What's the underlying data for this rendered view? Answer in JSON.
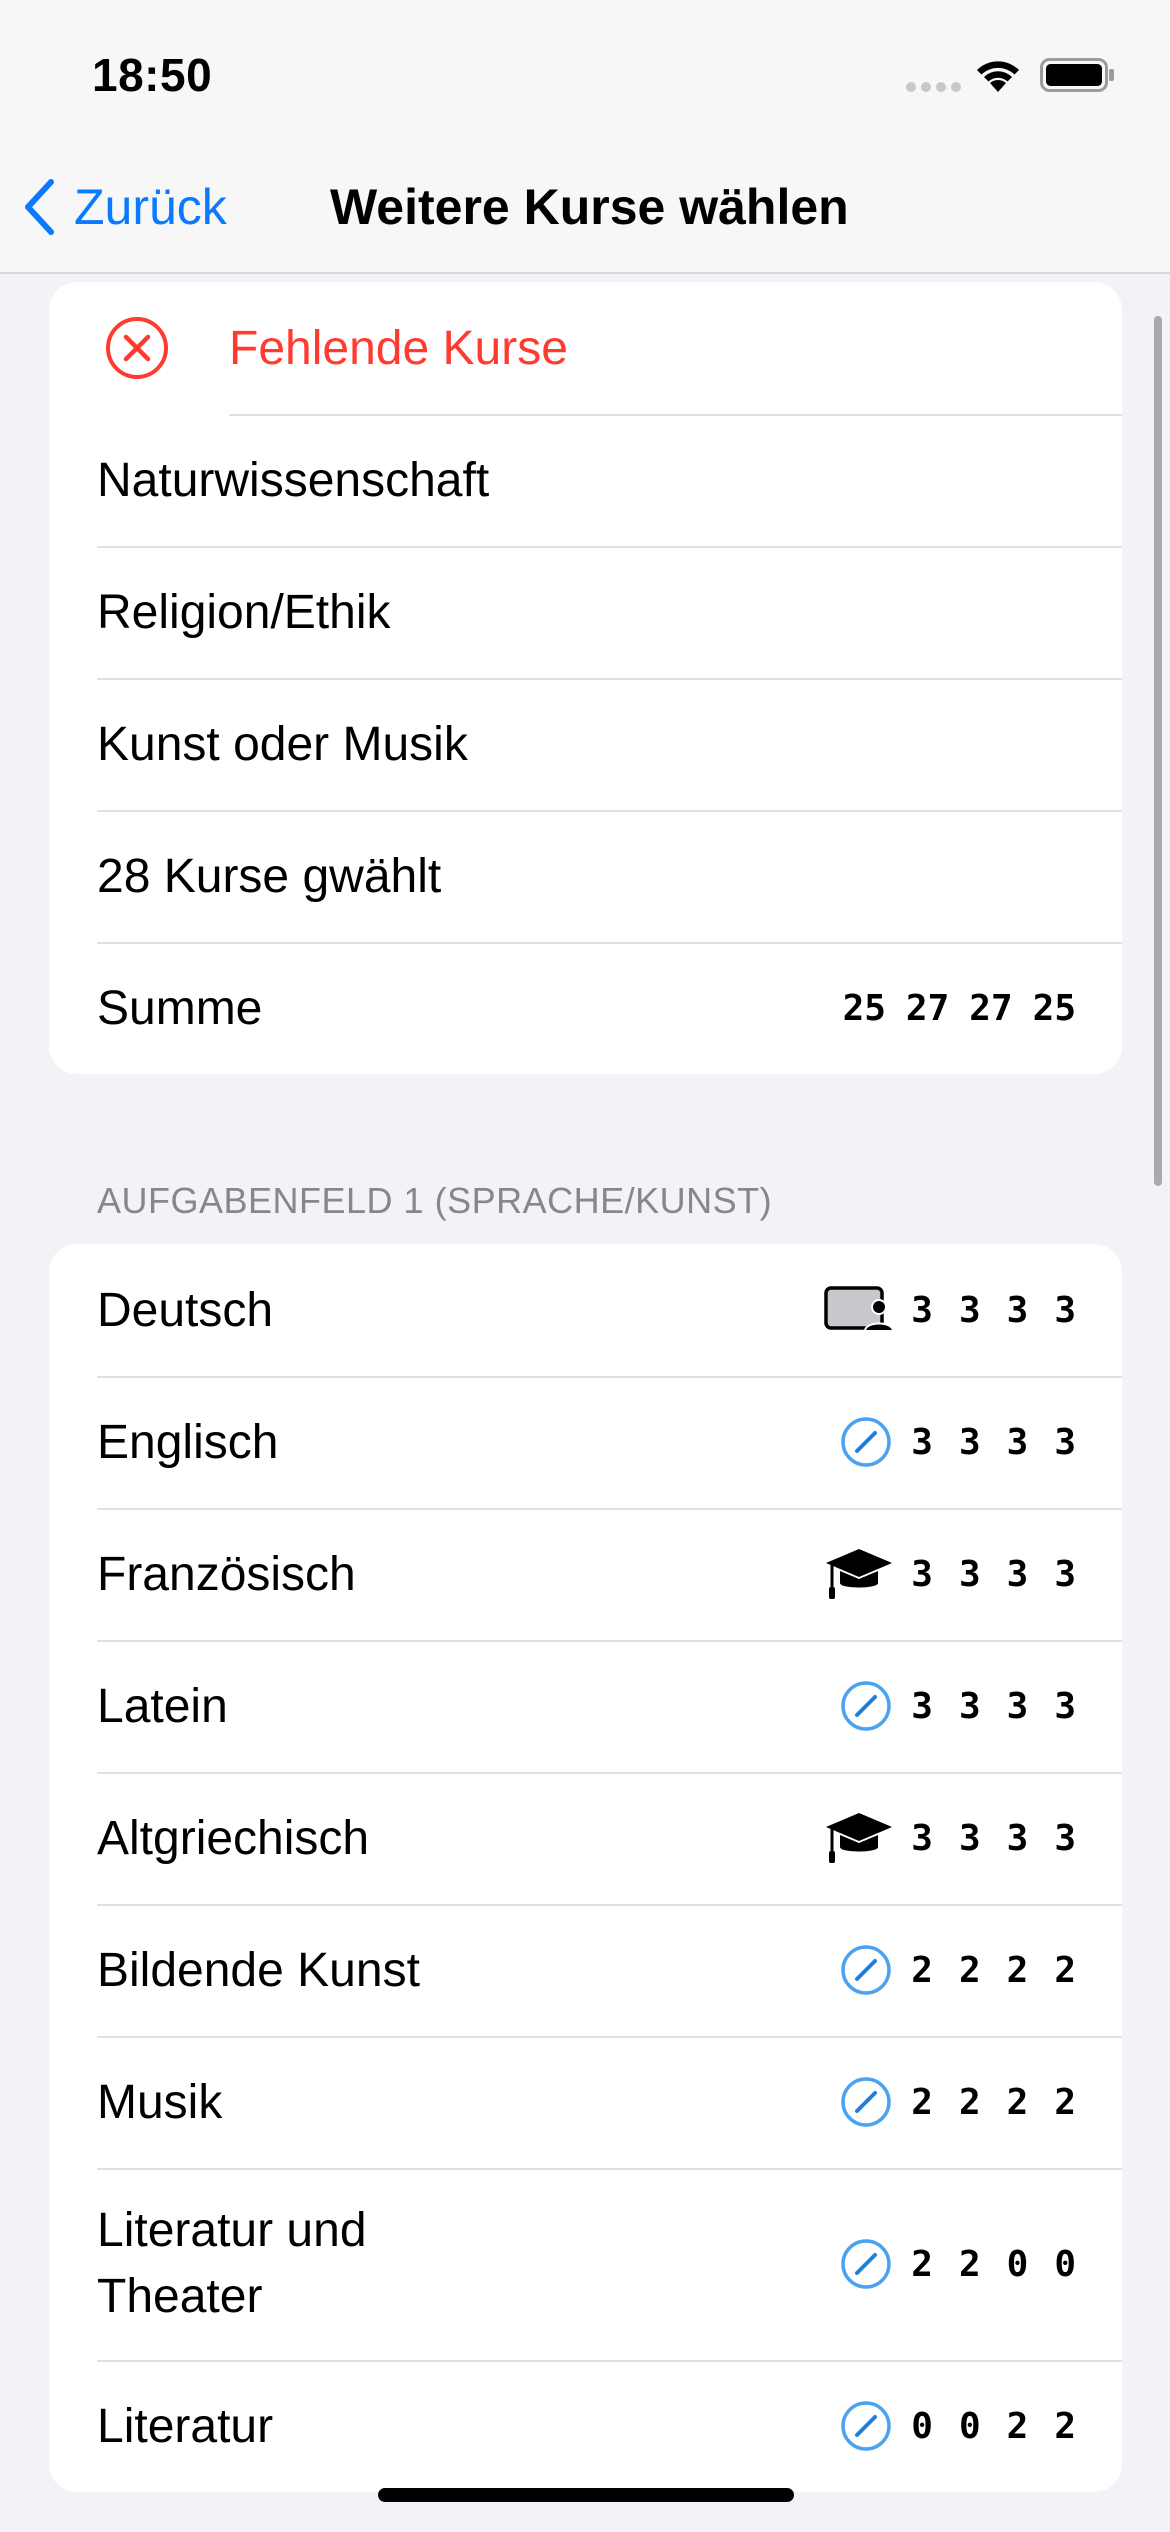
{
  "status": {
    "time": "18:50"
  },
  "nav": {
    "back_label": "Zurück",
    "title": "Weitere Kurse wählen"
  },
  "summary": {
    "error_label": "Fehlende Kurse",
    "items": [
      "Naturwissenschaft",
      "Religion/Ethik",
      "Kunst oder Musik",
      "28 Kurse gwählt"
    ],
    "sum_label": "Summe",
    "sum_values": [
      "25",
      "27",
      "27",
      "25"
    ]
  },
  "section1": {
    "header": "AUFGABENFELD 1 (SPRACHE/KUNST)",
    "courses": [
      {
        "name": "Deutsch",
        "icon": "presentation-person-icon",
        "values": [
          "3",
          "3",
          "3",
          "3"
        ]
      },
      {
        "name": "Englisch",
        "icon": "pencil-circle-icon",
        "values": [
          "3",
          "3",
          "3",
          "3"
        ]
      },
      {
        "name": "Französisch",
        "icon": "graduation-cap-icon",
        "values": [
          "3",
          "3",
          "3",
          "3"
        ]
      },
      {
        "name": "Latein",
        "icon": "pencil-circle-icon",
        "values": [
          "3",
          "3",
          "3",
          "3"
        ]
      },
      {
        "name": "Altgriechisch",
        "icon": "graduation-cap-icon",
        "values": [
          "3",
          "3",
          "3",
          "3"
        ]
      },
      {
        "name": "Bildende Kunst",
        "icon": "pencil-circle-icon",
        "values": [
          "2",
          "2",
          "2",
          "2"
        ]
      },
      {
        "name": "Musik",
        "icon": "pencil-circle-icon",
        "values": [
          "2",
          "2",
          "2",
          "2"
        ]
      },
      {
        "name": "Literatur und Theater",
        "icon": "pencil-circle-icon",
        "values": [
          "2",
          "2",
          "0",
          "0"
        ]
      },
      {
        "name": "Literatur",
        "icon": "pencil-circle-icon",
        "values": [
          "0",
          "0",
          "2",
          "2"
        ]
      }
    ]
  },
  "colors": {
    "accent": "#0a7aff",
    "error": "#ff3b30",
    "pencil": "#4aa3f0"
  }
}
